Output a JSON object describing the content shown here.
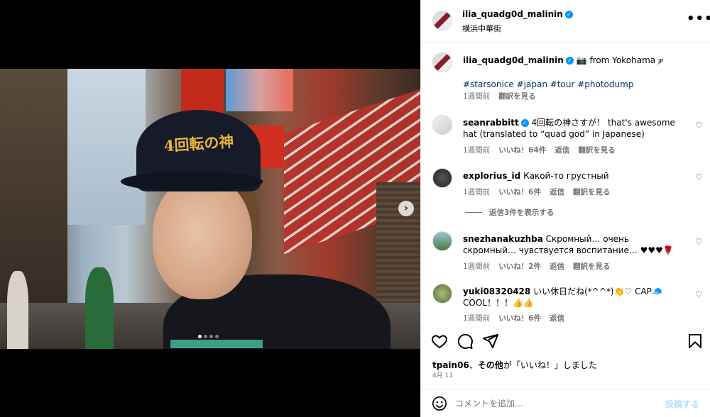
{
  "post": {
    "username": "ilia_quadg0d_malinin",
    "location": "横浜中華街",
    "more_label": "•••",
    "image_alt": "Young man wearing a black cap with gold embroidery '4回転の神' and a black hoodie on a Yokohama street",
    "cap_text": "4回転の神",
    "carousel_next": "›"
  },
  "caption": {
    "username": "ilia_quadg0d_malinin",
    "text_after": "from Yokohama",
    "flag": "JP",
    "hashtags": "#starsonice #japan #tour #photodump",
    "time": "1週間前",
    "translate": "翻訳を見る"
  },
  "comments": [
    {
      "username": "seanrabbitt",
      "verified": true,
      "text": "4回転の神さすが！ that's awesome hat (translated to “quad god” in Japanese)",
      "time": "1週間前",
      "likes": "いいね！64件",
      "reply": "返信",
      "translate": "翻訳を見る"
    },
    {
      "username": "explorius_id",
      "verified": false,
      "text": "Какой-то грустный",
      "time": "1週間前",
      "likes": "いいね！6件",
      "reply": "返信",
      "translate": "翻訳を見る"
    },
    {
      "username": "snezhanakuzhba",
      "verified": false,
      "text": "Скромный… очень скромный… чувствуется воспитание… ♥♥♥🌹",
      "time": "1週間前",
      "likes": "いいね！2件",
      "reply": "返信",
      "translate": "翻訳を見る"
    },
    {
      "username": "yuki08320428",
      "verified": false,
      "text": "いい休日だね(*^^*)👏♡ CAP🧢COOL！！！👍👍",
      "time": "1週間前",
      "likes": "いいね！6件",
      "reply": "返信",
      "translate": ""
    }
  ],
  "view_replies": "返信3件を表示する",
  "likes_line": {
    "user": "tpain06",
    "mid": "、",
    "others": "その他",
    "suffix": "が「いいね！」しました"
  },
  "date": "4月 11",
  "comment_box": {
    "placeholder": "コメントを追加...",
    "post_label": "投稿する"
  },
  "colors": {
    "accent": "#0095f6",
    "link": "#00376b",
    "muted": "#737373"
  },
  "icons": [
    "heart-icon",
    "comment-icon",
    "share-icon",
    "bookmark-icon",
    "emoji-icon",
    "verified-icon",
    "more-icon"
  ]
}
